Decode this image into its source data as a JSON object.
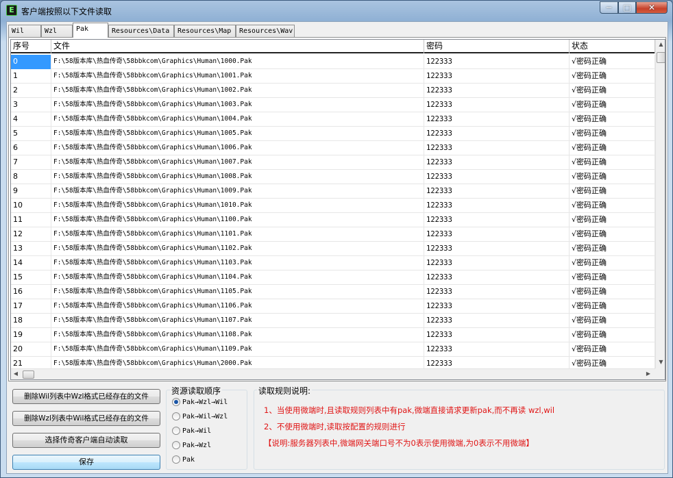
{
  "window": {
    "title": "客户端按照以下文件读取",
    "icon_letter": "E",
    "minimize_symbol": "─",
    "maximize_symbol": "□",
    "close_symbol": "✕"
  },
  "tabs": [
    "Wil",
    "Wzl",
    "Pak",
    "Resources\\Data",
    "Resources\\Map",
    "Resources\\Wav"
  ],
  "active_tab": "Pak",
  "table": {
    "columns": [
      "序号",
      "文件",
      "密码",
      "状态"
    ],
    "rows": [
      {
        "index": "0",
        "file": "F:\\58版本库\\热血传奇\\58bbkcom\\Graphics\\Human\\1000.Pak",
        "password": "122333",
        "status": "√密码正确"
      },
      {
        "index": "1",
        "file": "F:\\58版本库\\热血传奇\\58bbkcom\\Graphics\\Human\\1001.Pak",
        "password": "122333",
        "status": "√密码正确"
      },
      {
        "index": "2",
        "file": "F:\\58版本库\\热血传奇\\58bbkcom\\Graphics\\Human\\1002.Pak",
        "password": "122333",
        "status": "√密码正确"
      },
      {
        "index": "3",
        "file": "F:\\58版本库\\热血传奇\\58bbkcom\\Graphics\\Human\\1003.Pak",
        "password": "122333",
        "status": "√密码正确"
      },
      {
        "index": "4",
        "file": "F:\\58版本库\\热血传奇\\58bbkcom\\Graphics\\Human\\1004.Pak",
        "password": "122333",
        "status": "√密码正确"
      },
      {
        "index": "5",
        "file": "F:\\58版本库\\热血传奇\\58bbkcom\\Graphics\\Human\\1005.Pak",
        "password": "122333",
        "status": "√密码正确"
      },
      {
        "index": "6",
        "file": "F:\\58版本库\\热血传奇\\58bbkcom\\Graphics\\Human\\1006.Pak",
        "password": "122333",
        "status": "√密码正确"
      },
      {
        "index": "7",
        "file": "F:\\58版本库\\热血传奇\\58bbkcom\\Graphics\\Human\\1007.Pak",
        "password": "122333",
        "status": "√密码正确"
      },
      {
        "index": "8",
        "file": "F:\\58版本库\\热血传奇\\58bbkcom\\Graphics\\Human\\1008.Pak",
        "password": "122333",
        "status": "√密码正确"
      },
      {
        "index": "9",
        "file": "F:\\58版本库\\热血传奇\\58bbkcom\\Graphics\\Human\\1009.Pak",
        "password": "122333",
        "status": "√密码正确"
      },
      {
        "index": "10",
        "file": "F:\\58版本库\\热血传奇\\58bbkcom\\Graphics\\Human\\1010.Pak",
        "password": "122333",
        "status": "√密码正确"
      },
      {
        "index": "11",
        "file": "F:\\58版本库\\热血传奇\\58bbkcom\\Graphics\\Human\\1100.Pak",
        "password": "122333",
        "status": "√密码正确"
      },
      {
        "index": "12",
        "file": "F:\\58版本库\\热血传奇\\58bbkcom\\Graphics\\Human\\1101.Pak",
        "password": "122333",
        "status": "√密码正确"
      },
      {
        "index": "13",
        "file": "F:\\58版本库\\热血传奇\\58bbkcom\\Graphics\\Human\\1102.Pak",
        "password": "122333",
        "status": "√密码正确"
      },
      {
        "index": "14",
        "file": "F:\\58版本库\\热血传奇\\58bbkcom\\Graphics\\Human\\1103.Pak",
        "password": "122333",
        "status": "√密码正确"
      },
      {
        "index": "15",
        "file": "F:\\58版本库\\热血传奇\\58bbkcom\\Graphics\\Human\\1104.Pak",
        "password": "122333",
        "status": "√密码正确"
      },
      {
        "index": "16",
        "file": "F:\\58版本库\\热血传奇\\58bbkcom\\Graphics\\Human\\1105.Pak",
        "password": "122333",
        "status": "√密码正确"
      },
      {
        "index": "17",
        "file": "F:\\58版本库\\热血传奇\\58bbkcom\\Graphics\\Human\\1106.Pak",
        "password": "122333",
        "status": "√密码正确"
      },
      {
        "index": "18",
        "file": "F:\\58版本库\\热血传奇\\58bbkcom\\Graphics\\Human\\1107.Pak",
        "password": "122333",
        "status": "√密码正确"
      },
      {
        "index": "19",
        "file": "F:\\58版本库\\热血传奇\\58bbkcom\\Graphics\\Human\\1108.Pak",
        "password": "122333",
        "status": "√密码正确"
      },
      {
        "index": "20",
        "file": "F:\\58版本库\\热血传奇\\58bbkcom\\Graphics\\Human\\1109.Pak",
        "password": "122333",
        "status": "√密码正确"
      },
      {
        "index": "21",
        "file": "F:\\58版本库\\热血传奇\\58bbkcom\\Graphics\\Human\\2000.Pak",
        "password": "122333",
        "status": "√密码正确"
      }
    ],
    "selected_row_index": "0"
  },
  "buttons": {
    "delete_wil": "删除Wil列表中Wzl格式已经存在的文件",
    "delete_wzl": "删除Wzl列表中Wil格式已经存在的文件",
    "auto_read": "选择传奇客户端自动读取",
    "save": "保存"
  },
  "read_order": {
    "title": "资源读取顺序",
    "options": [
      "Pak→Wzl→Wil",
      "Pak→Wil→Wzl",
      "Pak→Wil",
      "Pak→Wzl",
      "Pak"
    ],
    "selected": "Pak→Wzl→Wil"
  },
  "rules": {
    "title": "读取规则说明:",
    "line1": "1、当使用微端时,且读取规则列表中有pak,微端直接请求更新pak,而不再读 wzl,wil",
    "line2": "2、不使用微端时,读取按配置的规则进行",
    "line3": "【说明:服务器列表中,微端网关端口号不为0表示使用微端,为0表示不用微端】"
  },
  "colors": {
    "selection": "#3399ff",
    "rule_text": "#e01414"
  }
}
